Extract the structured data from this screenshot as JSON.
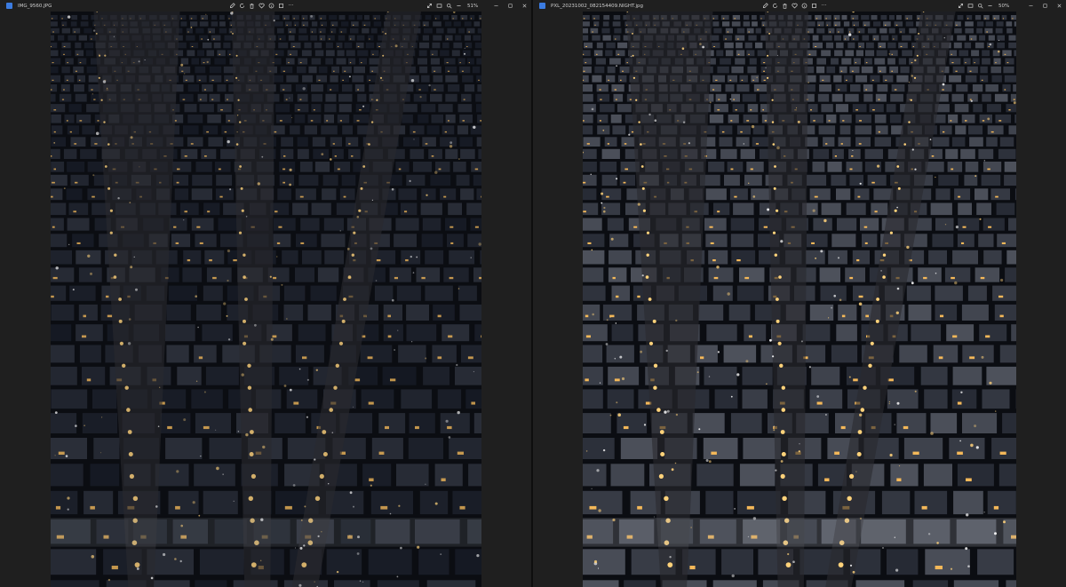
{
  "viewers": [
    {
      "file_name": "IMG_9560.JPG",
      "zoom": "51%",
      "brightness": 0.55,
      "toolbar_icons": [
        "edit-icon",
        "rotate-icon",
        "delete-icon",
        "favorite-icon",
        "info-icon",
        "copy-icon",
        "more-icon"
      ],
      "right_icons": [
        "expand-icon",
        "filmstrip-icon",
        "zoom-icon",
        "zoom-out-icon"
      ]
    },
    {
      "file_name": "PXL_20231002_082154409.NIGHT.jpg",
      "zoom": "50%",
      "brightness": 1.0,
      "toolbar_icons": [
        "edit-icon",
        "rotate-icon",
        "delete-icon",
        "favorite-icon",
        "info-icon",
        "copy-icon",
        "more-icon"
      ],
      "right_icons": [
        "expand-icon",
        "filmstrip-icon",
        "zoom-icon",
        "zoom-out-icon"
      ]
    }
  ],
  "window_controls": [
    "minimize-icon",
    "maximize-icon",
    "close-icon"
  ],
  "colors": {
    "background": "#1f1f1f",
    "night_sky": "#0b0d12",
    "street_light": "#ffd27a",
    "window_light": "#f4b859"
  }
}
